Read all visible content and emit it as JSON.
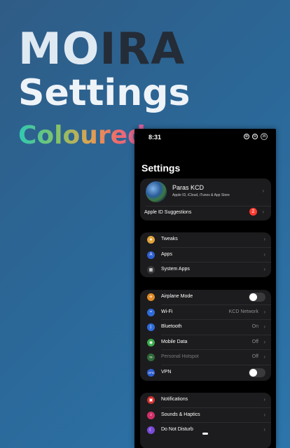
{
  "hero": {
    "title_a": "MO",
    "title_b": "IRA",
    "line2": "Settings",
    "line3": "Coloured"
  },
  "status": {
    "time": "8:31",
    "icon1": "⊕",
    "icon2": "⊖",
    "battery": "35"
  },
  "page": {
    "title": "Settings"
  },
  "profile": {
    "name": "Paras KCD",
    "subtitle": "Apple ID, iCloud, iTunes & App Store",
    "suggestions": "Apple ID Suggestions",
    "badge": "2"
  },
  "group1": [
    {
      "label": "Tweaks",
      "icon": "tweaks-icon",
      "color": "#e0a43a"
    },
    {
      "label": "Apps",
      "icon": "apps-icon",
      "color": "#2f5fd0"
    },
    {
      "label": "System Apps",
      "icon": "system-apps-icon",
      "color": "#3a3a3c"
    }
  ],
  "group2": [
    {
      "label": "Airplane Mode",
      "icon": "airplane-icon",
      "color": "#e08a26",
      "toggle": false
    },
    {
      "label": "Wi-Fi",
      "value": "KCD Network",
      "icon": "wifi-icon",
      "color": "#2f6bd8"
    },
    {
      "label": "Bluetooth",
      "value": "On",
      "icon": "bluetooth-icon",
      "color": "#2f6bd8"
    },
    {
      "label": "Mobile Data",
      "value": "Off",
      "icon": "mobile-data-icon",
      "color": "#3aaa4a"
    },
    {
      "label": "Personal Hotspot",
      "value": "Off",
      "icon": "hotspot-icon",
      "color": "#2f6a3a"
    },
    {
      "label": "VPN",
      "icon": "vpn-icon",
      "color": "#2f5fd0",
      "toggle": false
    }
  ],
  "group3": [
    {
      "label": "Notifications",
      "icon": "notifications-icon",
      "color": "#d03030"
    },
    {
      "label": "Sounds & Haptics",
      "icon": "sounds-icon",
      "color": "#d0306a"
    },
    {
      "label": "Do Not Disturb",
      "icon": "do-not-disturb-icon",
      "color": "#7a4ad8"
    }
  ]
}
